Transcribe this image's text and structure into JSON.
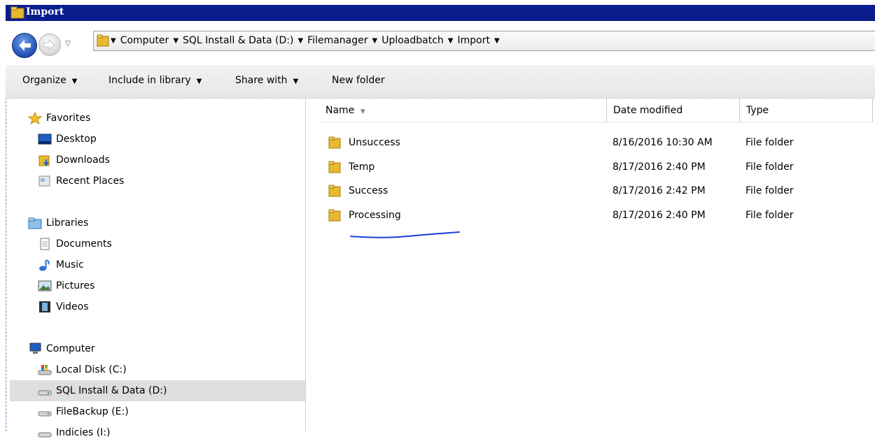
{
  "window": {
    "title": "Import"
  },
  "address": {
    "crumbs": [
      "Computer",
      "SQL Install & Data (D:)",
      "Filemanager",
      "Uploadbatch",
      "Import"
    ]
  },
  "toolbar": {
    "organize": "Organize",
    "include_in_library": "Include in library",
    "share_with": "Share with",
    "new_folder": "New folder"
  },
  "nav": {
    "favorites": {
      "label": "Favorites",
      "items": [
        "Desktop",
        "Downloads",
        "Recent Places"
      ]
    },
    "libraries": {
      "label": "Libraries",
      "items": [
        "Documents",
        "Music",
        "Pictures",
        "Videos"
      ]
    },
    "computer": {
      "label": "Computer",
      "items": [
        "Local Disk (C:)",
        "SQL Install & Data (D:)",
        "FileBackup (E:)",
        "Indicies (I:)"
      ]
    }
  },
  "columns": {
    "name": "Name",
    "date_modified": "Date modified",
    "type": "Type"
  },
  "files": [
    {
      "name": "Unsuccess",
      "date": "8/16/2016 10:30 AM",
      "type": "File folder"
    },
    {
      "name": "Temp",
      "date": "8/17/2016 2:40 PM",
      "type": "File folder"
    },
    {
      "name": "Success",
      "date": "8/17/2016 2:42 PM",
      "type": "File folder"
    },
    {
      "name": "Processing",
      "date": "8/17/2016 2:40 PM",
      "type": "File folder"
    }
  ],
  "colors": {
    "titlebar": "#0a1d8c",
    "annotation": "#1a3fd6",
    "selected": "#dedede"
  }
}
